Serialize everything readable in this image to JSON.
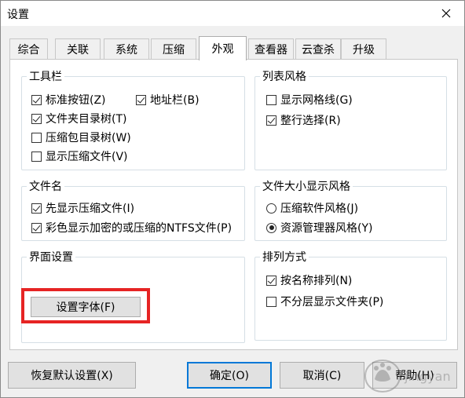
{
  "window": {
    "title": "设置"
  },
  "tabs": [
    "综合",
    "关联",
    "系统",
    "压缩",
    "外观",
    "查看器",
    "云查杀",
    "升级"
  ],
  "active_tab": "外观",
  "groups": {
    "toolbar": {
      "title": "工具栏",
      "std_buttons": "标准按钮(Z)",
      "address_bar": "地址栏(B)",
      "folder_tree": "文件夹目录树(T)",
      "archive_tree": "压缩包目录树(W)",
      "show_archives": "显示压缩文件(V)"
    },
    "list_style": {
      "title": "列表风格",
      "grid_lines": "显示网格线(G)",
      "row_select": "整行选择(R)"
    },
    "filename": {
      "title": "文件名",
      "archives_first": "先显示压缩文件(I)",
      "color_ntfs": "彩色显示加密的或压缩的NTFS文件(P)"
    },
    "size_style": {
      "title": "文件大小显示风格",
      "compress_style": "压缩软件风格(J)",
      "explorer_style": "资源管理器风格(Y)"
    },
    "ui_settings": {
      "title": "界面设置",
      "font_button": "设置字体(F)"
    },
    "sort": {
      "title": "排列方式",
      "by_name": "按名称排列(N)",
      "no_folder_layer": "不分层显示文件夹(P)"
    }
  },
  "buttons": {
    "restore": "恢复默认设置(X)",
    "ok": "确定(O)",
    "cancel": "取消(C)",
    "help": "帮助(H)"
  },
  "watermark": "Baidu经验"
}
